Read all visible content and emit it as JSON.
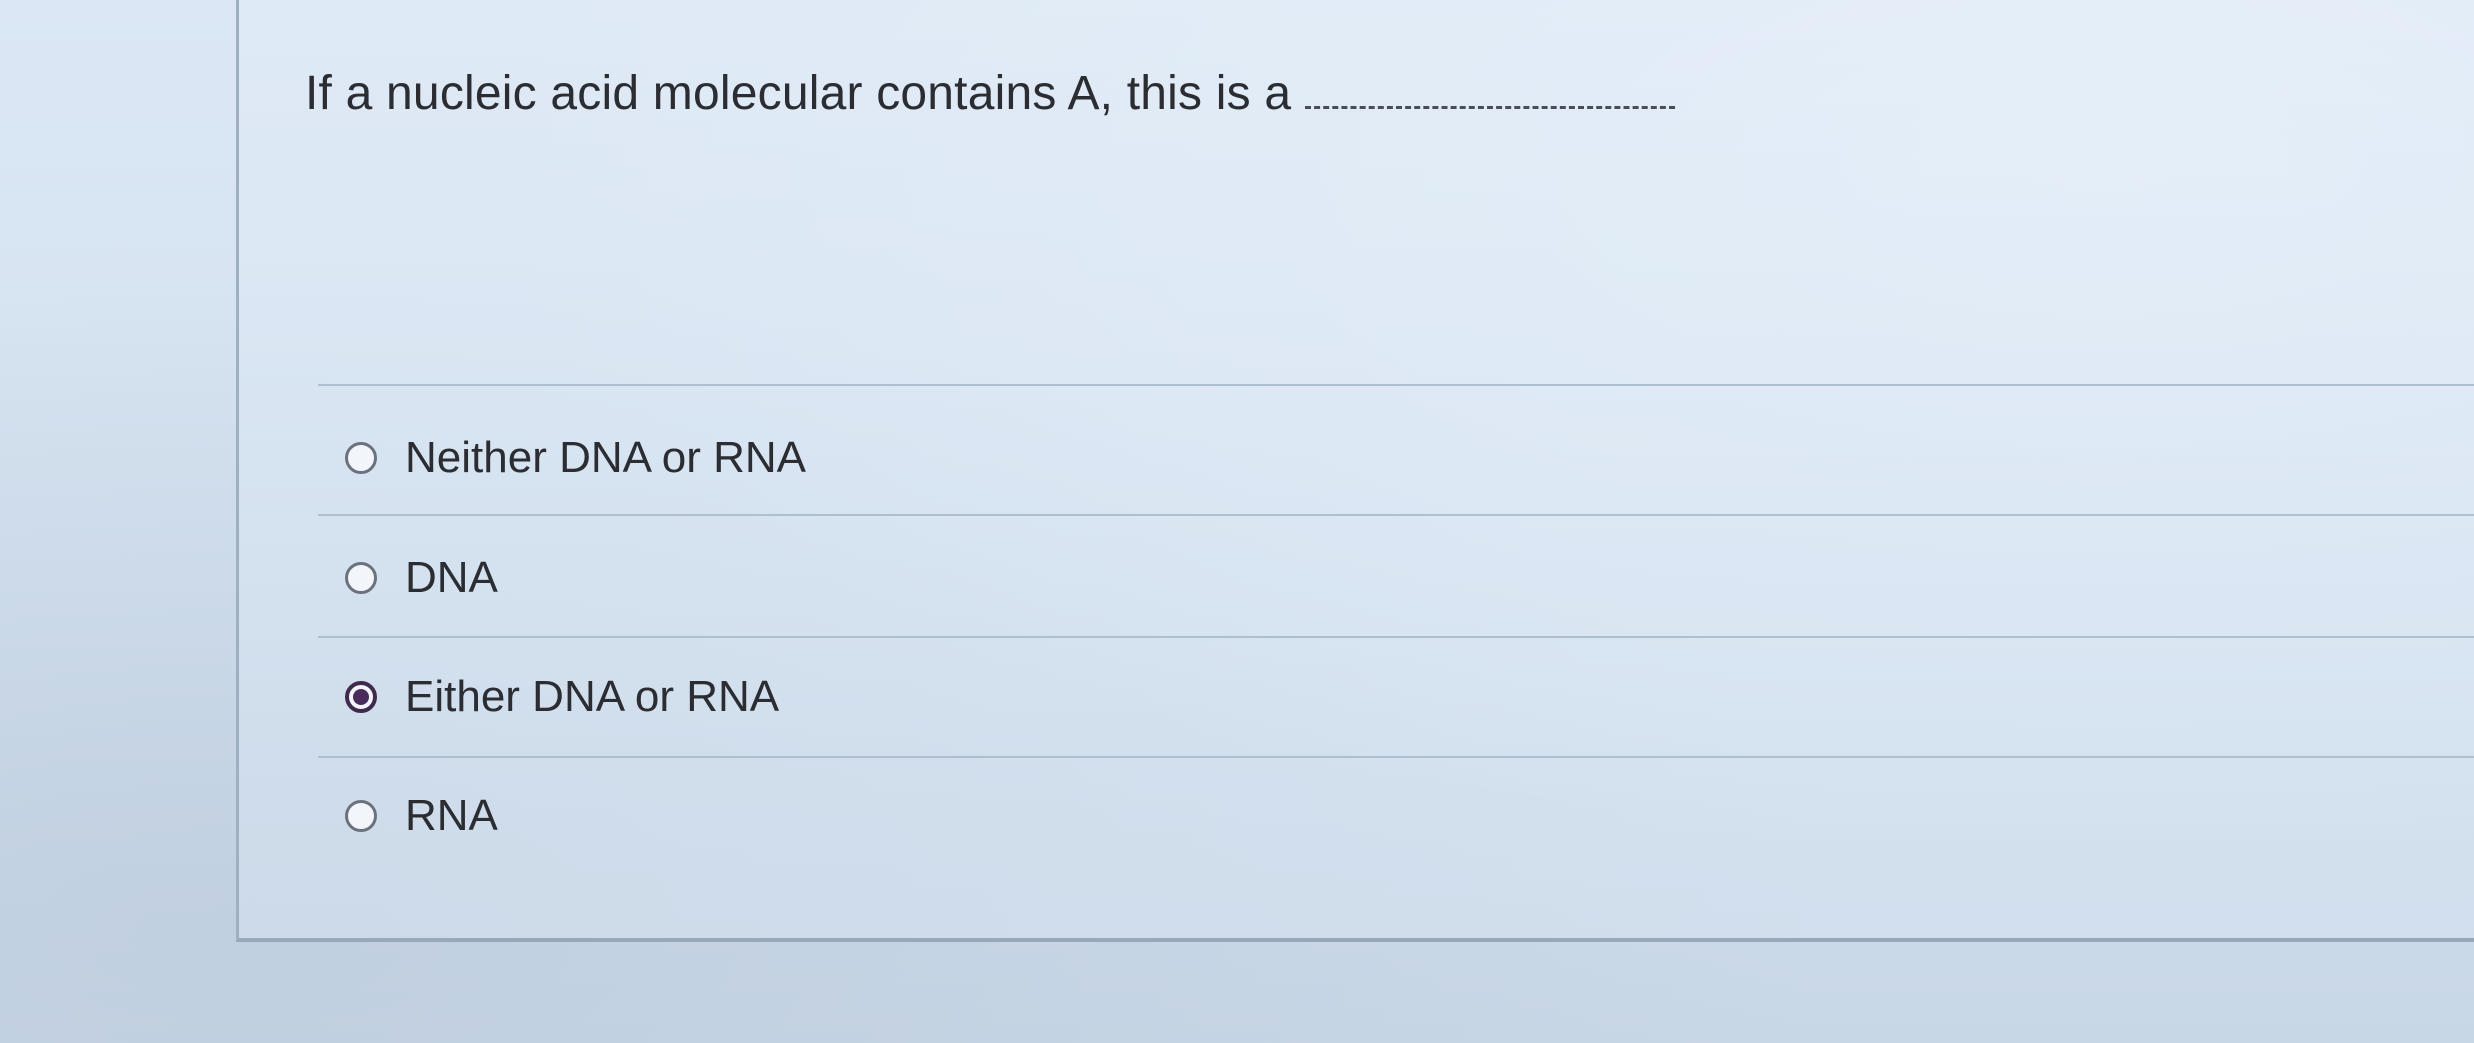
{
  "question": {
    "text": "If a nucleic acid molecular contains A, this is a"
  },
  "options": [
    {
      "label": "Neither DNA or RNA",
      "selected": false
    },
    {
      "label": "DNA",
      "selected": false
    },
    {
      "label": "Either DNA or RNA",
      "selected": true
    },
    {
      "label": "RNA",
      "selected": false
    }
  ],
  "colors": {
    "selected_radio": "#4a2c5c",
    "text": "#2b2d33",
    "divider": "#aebfd0"
  }
}
